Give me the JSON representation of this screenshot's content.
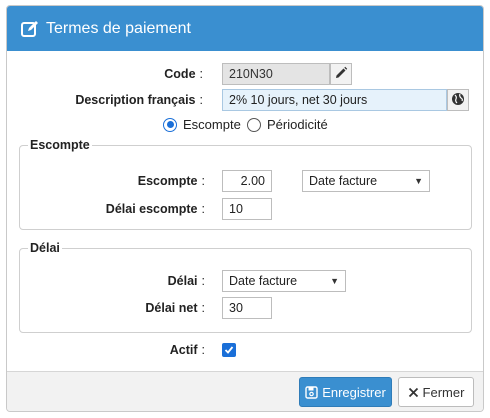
{
  "dialog": {
    "title": "Termes de paiement"
  },
  "form": {
    "code_label": "Code",
    "code_value": "210N30",
    "description_label": "Description français",
    "description_value": "2% 10 jours, net 30 jours",
    "radio_escompte": "Escompte",
    "radio_periodicite": "Périodicité",
    "selected_radio": "Escompte"
  },
  "escompte_group": {
    "legend": "Escompte",
    "escompte_label": "Escompte",
    "escompte_value": "2.00",
    "escompte_select": "Date facture",
    "delai_label": "Délai escompte",
    "delai_value": "10"
  },
  "delai_group": {
    "legend": "Délai",
    "delai_label": "Délai",
    "delai_select": "Date facture",
    "net_label": "Délai net",
    "net_value": "30"
  },
  "actif": {
    "label": "Actif",
    "checked": true
  },
  "colon": ":",
  "footer": {
    "save_label": "Enregistrer",
    "close_label": "Fermer"
  },
  "colors": {
    "header": "#3a8fd0",
    "primary": "#3a8fd0",
    "check": "#1a6fd8"
  }
}
